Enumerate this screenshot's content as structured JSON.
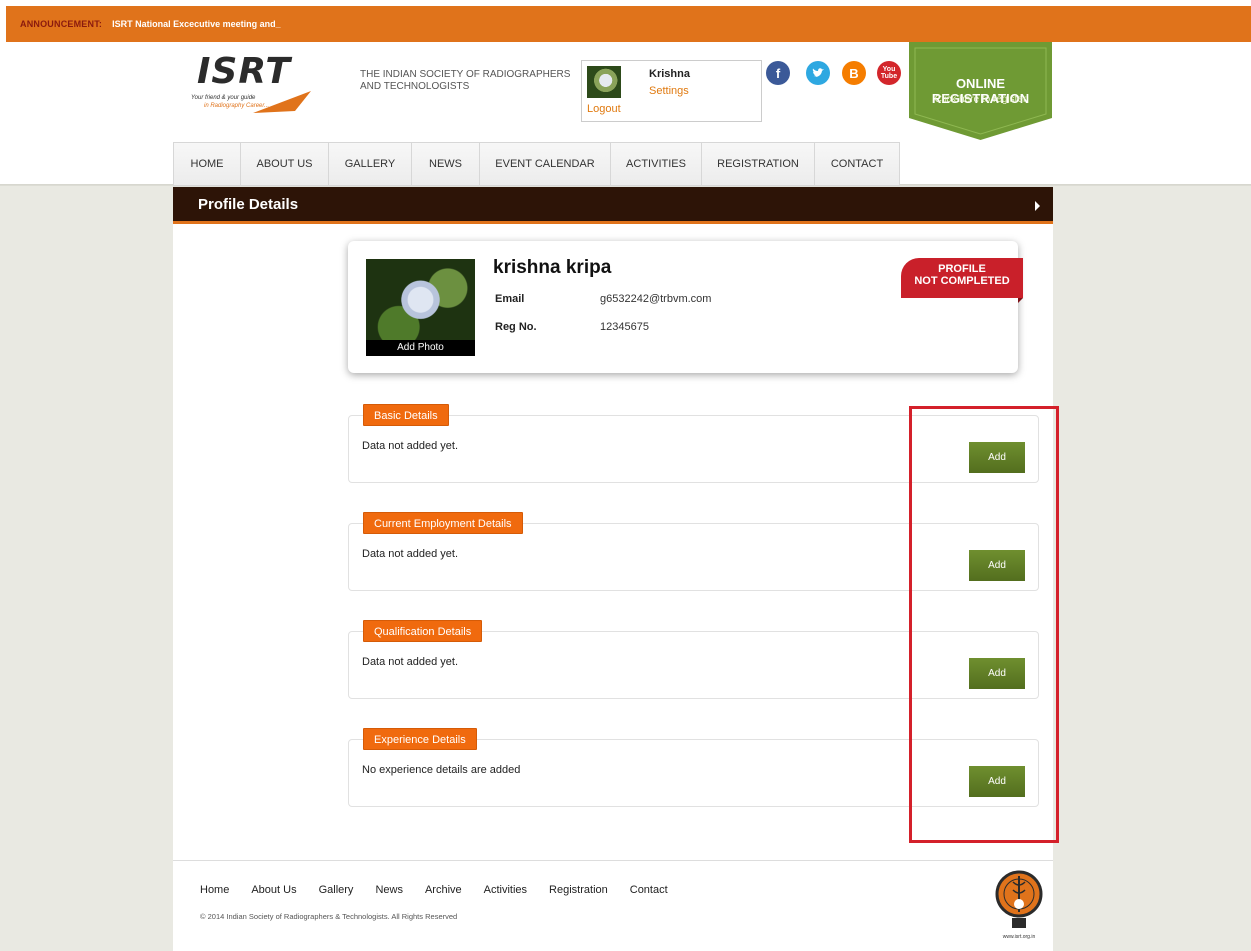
{
  "announcement": {
    "label": "ANNOUNCEMENT:",
    "text": "ISRT National Excecutive meeting and_"
  },
  "header": {
    "logo_text": "ISRT",
    "logo_tagline_1": "Your friend & your guide",
    "logo_tagline_2": "in Radiography Career...",
    "org_name": "THE INDIAN SOCIETY OF RADIOGRAPHERS AND TECHNOLOGISTS"
  },
  "user": {
    "name": "Krishna",
    "settings_label": "Settings",
    "logout_label": "Logout"
  },
  "social": [
    {
      "name": "facebook-icon",
      "glyph": "f",
      "color": "#3b5998"
    },
    {
      "name": "twitter-icon",
      "glyph": "t",
      "color": "#2ea8e1"
    },
    {
      "name": "blogger-icon",
      "glyph": "B",
      "color": "#f57d00"
    },
    {
      "name": "youtube-icon",
      "glyph": "You Tube",
      "color": "#d3262b"
    }
  ],
  "registration_banner": {
    "title": "ONLINE REGISTRATION",
    "subtitle": "Click here to register",
    "color": "#6f9a34"
  },
  "nav": [
    "HOME",
    "ABOUT US",
    "GALLERY",
    "NEWS",
    "EVENT CALENDAR",
    "ACTIVITIES",
    "REGISTRATION",
    "CONTACT"
  ],
  "page": {
    "title": "Profile Details"
  },
  "profile": {
    "name": "krishna kripa",
    "add_photo_label": "Add Photo",
    "email_label": "Email",
    "email_value": "g6532242@trbvm.com",
    "reg_label": "Reg No.",
    "reg_value": "12345675",
    "status_line_1": "PROFILE",
    "status_line_2": "NOT COMPLETED"
  },
  "sections": [
    {
      "title": "Basic Details",
      "message": "Data not added yet.",
      "button": "Add"
    },
    {
      "title": "Current Employment Details",
      "message": "Data not added yet.",
      "button": "Add"
    },
    {
      "title": "Qualification Details",
      "message": "Data not added yet.",
      "button": "Add"
    },
    {
      "title": "Experience Details",
      "message": "No experience details are added",
      "button": "Add"
    }
  ],
  "footer": {
    "links": [
      "Home",
      "About Us",
      "Gallery",
      "News",
      "Archive",
      "Activities",
      "Registration",
      "Contact"
    ],
    "copyright": "© 2014 Indian Society of Radiographers & Technologists. All Rights Reserved",
    "seal_url": "www.isrt.org.in"
  },
  "colors": {
    "accent": "#e0731b",
    "dark_bar": "#2d1407",
    "button_green": "#5f7d25",
    "badge_red": "#c9202a"
  }
}
